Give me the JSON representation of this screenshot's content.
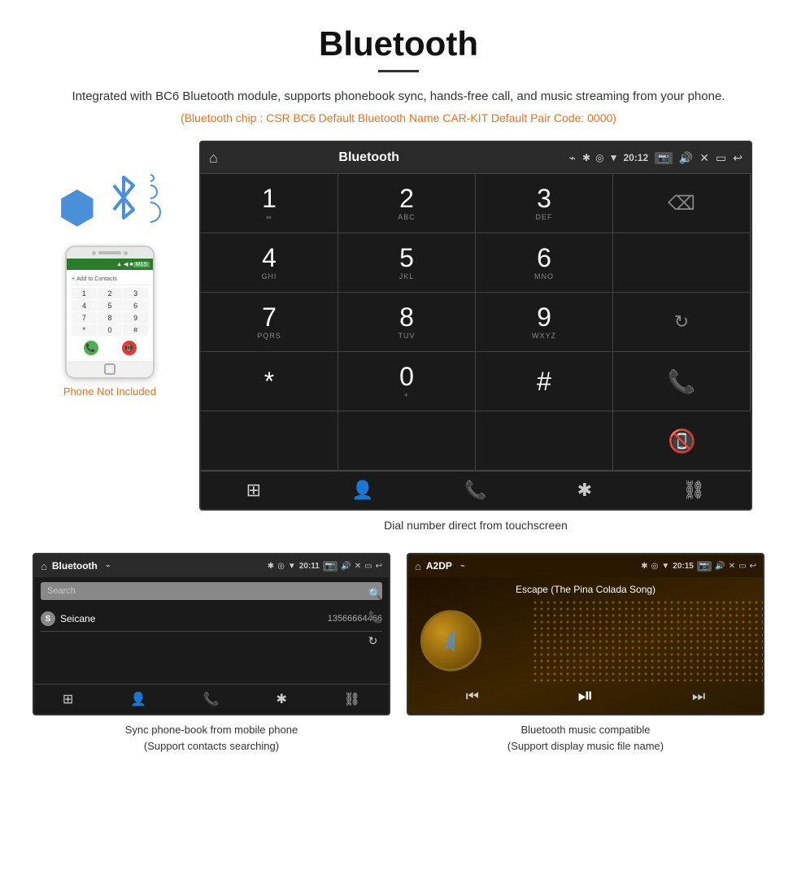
{
  "page": {
    "title": "Bluetooth",
    "subtitle": "Integrated with BC6 Bluetooth module, supports phonebook sync, hands-free call, and music streaming from your phone.",
    "specs": "(Bluetooth chip : CSR BC6    Default Bluetooth Name CAR-KIT    Default Pair Code: 0000)",
    "phone_not_included": "Phone Not Included",
    "dial_caption": "Dial number direct from touchscreen"
  },
  "car_screen": {
    "title": "Bluetooth",
    "time": "20:12",
    "usb_icon": "⌁",
    "home_icon": "⌂",
    "dialpad": [
      {
        "number": "1",
        "letters": "∞",
        "col": 1
      },
      {
        "number": "2",
        "letters": "ABC",
        "col": 2
      },
      {
        "number": "3",
        "letters": "DEF",
        "col": 3
      },
      {
        "number": "",
        "letters": "",
        "col": 4,
        "type": "backspace"
      },
      {
        "number": "4",
        "letters": "GHI",
        "col": 1
      },
      {
        "number": "5",
        "letters": "JKL",
        "col": 2
      },
      {
        "number": "6",
        "letters": "MNO",
        "col": 3
      },
      {
        "number": "",
        "letters": "",
        "col": 4,
        "type": "empty"
      },
      {
        "number": "7",
        "letters": "PQRS",
        "col": 1
      },
      {
        "number": "8",
        "letters": "TUV",
        "col": 2
      },
      {
        "number": "9",
        "letters": "WXYZ",
        "col": 3
      },
      {
        "number": "",
        "letters": "",
        "col": 4,
        "type": "reload"
      },
      {
        "number": "*",
        "letters": "",
        "col": 1
      },
      {
        "number": "0",
        "letters": "+",
        "col": 2,
        "type": "zero"
      },
      {
        "number": "#",
        "letters": "",
        "col": 3
      },
      {
        "number": "",
        "letters": "",
        "col": 4,
        "type": "call_green"
      },
      {
        "number": "",
        "letters": "",
        "col": 4,
        "type": "call_red"
      }
    ],
    "bottom_icons": [
      "⊞",
      "👤",
      "📞",
      "✱",
      "⛓"
    ]
  },
  "phonebook_screen": {
    "title": "Bluetooth",
    "time": "20:11",
    "search_placeholder": "Search",
    "contact_name": "Seicane",
    "contact_number": "13566664466",
    "contact_letter": "S",
    "caption_line1": "Sync phone-book from mobile phone",
    "caption_line2": "(Support contacts searching)"
  },
  "music_screen": {
    "title": "A2DP",
    "time": "20:15",
    "song_title": "Escape (The Pina Colada Song)",
    "caption_line1": "Bluetooth music compatible",
    "caption_line2": "(Support display music file name)"
  }
}
